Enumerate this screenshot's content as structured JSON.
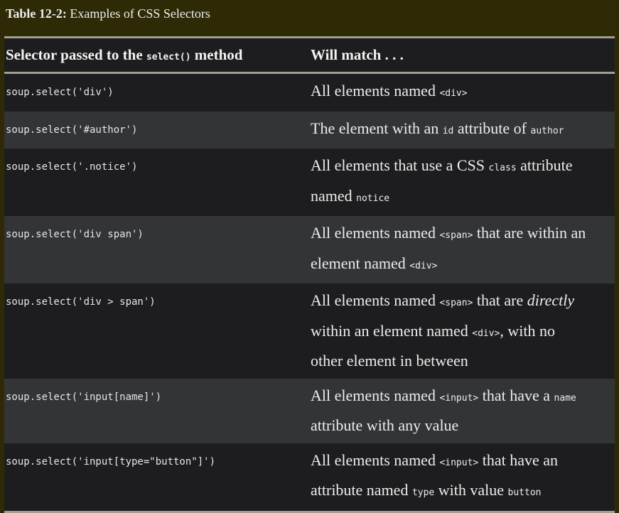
{
  "caption": {
    "label": "Table 12-2:",
    "text": " Examples of CSS Selectors"
  },
  "table": {
    "header": {
      "col1_pre": "Selector passed to the ",
      "col1_code": "select()",
      "col1_post": " method",
      "col2": "Will match . . ."
    },
    "rows": [
      {
        "selector": "soup.select('div')",
        "desc": [
          [
            "All elements named ",
            {
              "code": "<div>"
            }
          ]
        ]
      },
      {
        "selector": "soup.select('#author')",
        "desc": [
          [
            "The element with an ",
            {
              "code": "id"
            },
            " attribute of ",
            {
              "code": "author"
            }
          ]
        ]
      },
      {
        "selector": "soup.select('.notice')",
        "desc": [
          [
            "All elements that use a CSS ",
            {
              "code": "class"
            },
            " attribute"
          ],
          [
            "named ",
            {
              "code": "notice"
            }
          ]
        ]
      },
      {
        "selector": "soup.select('div span')",
        "desc": [
          [
            "All elements named ",
            {
              "code": "<span>"
            },
            " that are within an"
          ],
          [
            "element named ",
            {
              "code": "<div>"
            }
          ]
        ]
      },
      {
        "selector": "soup.select('div > span')",
        "desc": [
          [
            "All elements named ",
            {
              "code": "<span>"
            },
            " that are ",
            {
              "em": "directly"
            }
          ],
          [
            "within an element named ",
            {
              "code": "<div>"
            },
            ", with no"
          ],
          [
            "other element in between"
          ]
        ]
      },
      {
        "selector": "soup.select('input[name]')",
        "desc": [
          [
            "All elements named ",
            {
              "code": "<input>"
            },
            " that have a ",
            {
              "code": "name"
            }
          ],
          [
            "attribute with any value"
          ]
        ]
      },
      {
        "selector": "soup.select('input[type=\"button\"]')",
        "desc": [
          [
            "All elements named ",
            {
              "code": "<input>"
            },
            " that have an"
          ],
          [
            "attribute named ",
            {
              "code": "type"
            },
            " with value ",
            {
              "code": "button"
            }
          ]
        ]
      }
    ]
  },
  "colors": {
    "page_background": "#2d2a05",
    "row_dark": "#1d1d1f",
    "row_light": "#323436",
    "rule": "#a49e8d"
  }
}
